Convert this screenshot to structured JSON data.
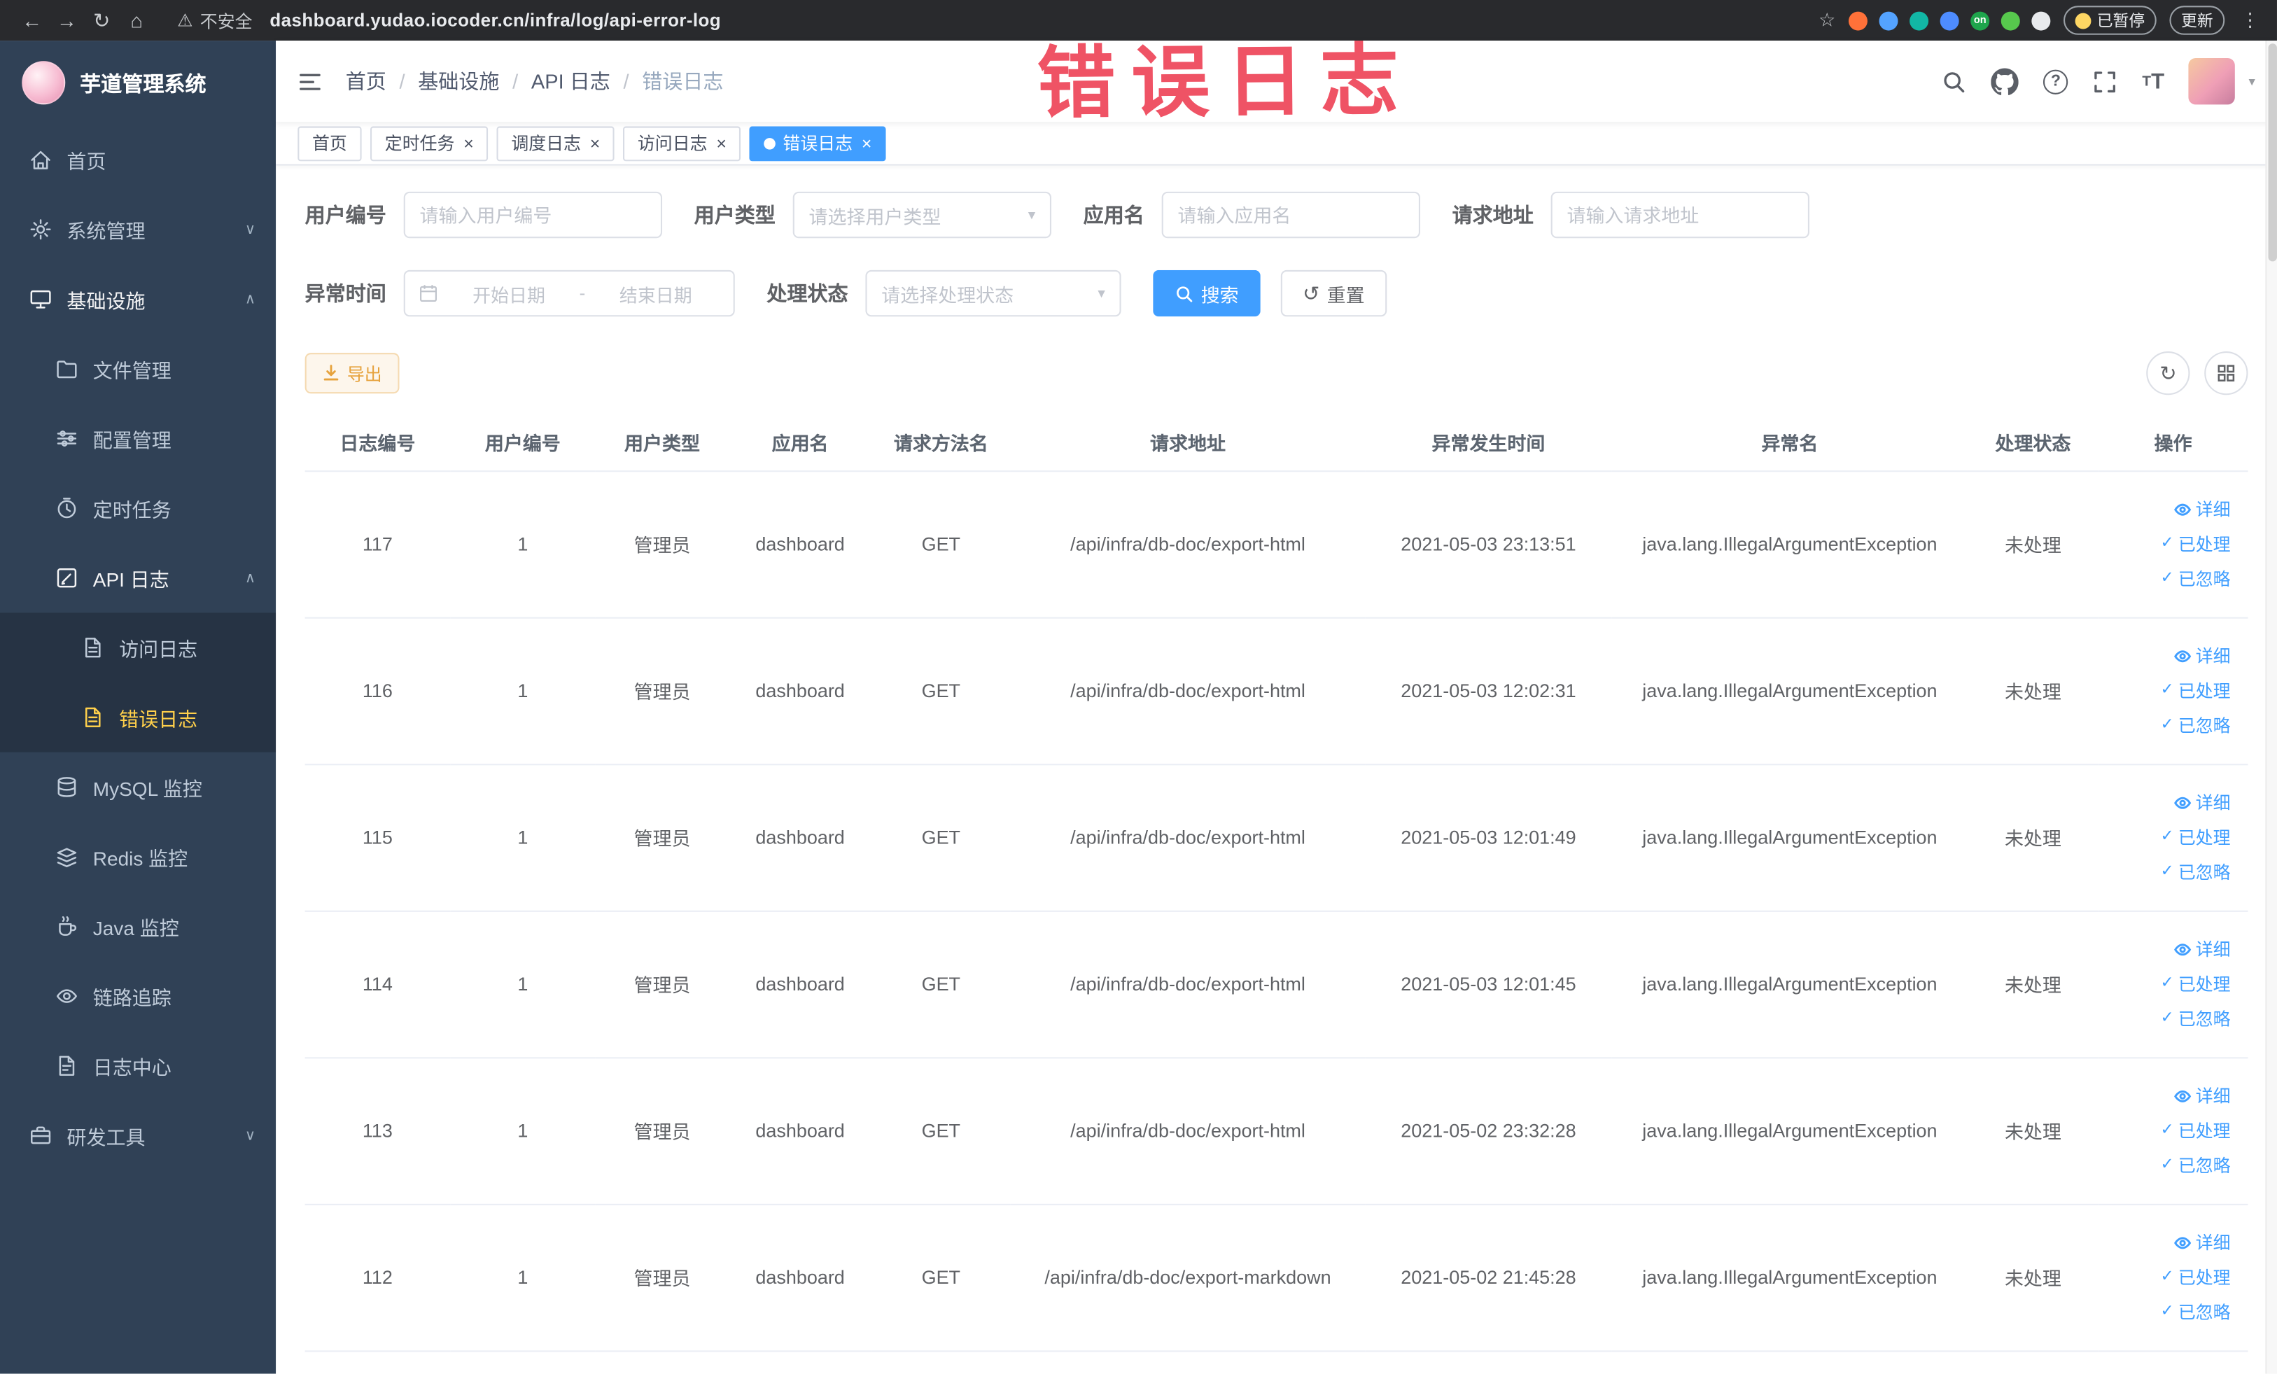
{
  "browser": {
    "security_label": "不安全",
    "url": "dashboard.yudao.iocoder.cn/infra/log/api-error-log",
    "extensions": [
      {
        "name": "ext-orange-icon",
        "color": "#ff7139"
      },
      {
        "name": "ext-blue-drop-icon",
        "color": "#54a3ff"
      },
      {
        "name": "ext-teal-icon",
        "color": "#12b7a5"
      },
      {
        "name": "ext-blue-grid-icon",
        "color": "#4e8cff"
      },
      {
        "name": "ext-on-badge-icon",
        "color": "#1ea54c",
        "label": "on"
      },
      {
        "name": "ext-leaf-icon",
        "color": "#57c84d"
      },
      {
        "name": "ext-paw-icon",
        "color": "#e8eaed"
      }
    ],
    "paused_label": "已暂停",
    "update_label": "更新"
  },
  "annotation": {
    "text": "错误日志"
  },
  "sidebar": {
    "title": "芋道管理系统",
    "items": [
      {
        "label": "首页",
        "icon": "home",
        "level": 1
      },
      {
        "label": "系统管理",
        "icon": "system",
        "level": 1,
        "chevron": "down"
      },
      {
        "label": "基础设施",
        "icon": "infra",
        "level": 1,
        "chevron": "up",
        "open": true
      },
      {
        "label": "文件管理",
        "icon": "file",
        "level": 2
      },
      {
        "label": "配置管理",
        "icon": "config",
        "level": 2
      },
      {
        "label": "定时任务",
        "icon": "timer",
        "level": 2
      },
      {
        "label": "API 日志",
        "icon": "api",
        "level": 2,
        "chevron": "up",
        "open": true
      },
      {
        "label": "访问日志",
        "icon": "doc",
        "level": 3
      },
      {
        "label": "错误日志",
        "icon": "doc",
        "level": 3,
        "active": true
      },
      {
        "label": "MySQL 监控",
        "icon": "mysql",
        "level": 2
      },
      {
        "label": "Redis 监控",
        "icon": "redis",
        "level": 2
      },
      {
        "label": "Java 监控",
        "icon": "java",
        "level": 2
      },
      {
        "label": "链路追踪",
        "icon": "trace",
        "level": 2
      },
      {
        "label": "日志中心",
        "icon": "logcenter",
        "level": 2
      },
      {
        "label": "研发工具",
        "icon": "tools",
        "level": 1,
        "chevron": "down"
      }
    ]
  },
  "header": {
    "separator": "/",
    "breadcrumb": [
      {
        "label": "首页"
      },
      {
        "label": "基础设施"
      },
      {
        "label": "API 日志"
      },
      {
        "label": "错误日志",
        "last": true
      }
    ]
  },
  "tags": [
    {
      "label": "首页"
    },
    {
      "label": "定时任务",
      "closable": true
    },
    {
      "label": "调度日志",
      "closable": true
    },
    {
      "label": "访问日志",
      "closable": true
    },
    {
      "label": "错误日志",
      "closable": true,
      "active": true
    }
  ],
  "filters": {
    "user_id": {
      "label": "用户编号",
      "placeholder": "请输入用户编号"
    },
    "user_type": {
      "label": "用户类型",
      "placeholder": "请选择用户类型"
    },
    "app_name": {
      "label": "应用名",
      "placeholder": "请输入应用名"
    },
    "request_url": {
      "label": "请求地址",
      "placeholder": "请输入请求地址"
    },
    "exception_time": {
      "label": "异常时间",
      "start_placeholder": "开始日期",
      "separator": "-",
      "end_placeholder": "结束日期"
    },
    "process_status": {
      "label": "处理状态",
      "placeholder": "请选择处理状态"
    },
    "search_label": "搜索",
    "reset_label": "重置"
  },
  "toolbar": {
    "export_label": "导出"
  },
  "table": {
    "columns": [
      "日志编号",
      "用户编号",
      "用户类型",
      "应用名",
      "请求方法名",
      "请求地址",
      "异常发生时间",
      "异常名",
      "处理状态",
      "操作"
    ],
    "actions": [
      "详细",
      "已处理",
      "已忽略"
    ],
    "rows": [
      {
        "id": "117",
        "user_id": "1",
        "user_type": "管理员",
        "app": "dashboard",
        "method": "GET",
        "url": "/api/infra/db-doc/export-html",
        "time": "2021-05-03 23:13:51",
        "exception": "java.lang.IllegalArgumentException",
        "status": "未处理"
      },
      {
        "id": "116",
        "user_id": "1",
        "user_type": "管理员",
        "app": "dashboard",
        "method": "GET",
        "url": "/api/infra/db-doc/export-html",
        "time": "2021-05-03 12:02:31",
        "exception": "java.lang.IllegalArgumentException",
        "status": "未处理"
      },
      {
        "id": "115",
        "user_id": "1",
        "user_type": "管理员",
        "app": "dashboard",
        "method": "GET",
        "url": "/api/infra/db-doc/export-html",
        "time": "2021-05-03 12:01:49",
        "exception": "java.lang.IllegalArgumentException",
        "status": "未处理"
      },
      {
        "id": "114",
        "user_id": "1",
        "user_type": "管理员",
        "app": "dashboard",
        "method": "GET",
        "url": "/api/infra/db-doc/export-html",
        "time": "2021-05-03 12:01:45",
        "exception": "java.lang.IllegalArgumentException",
        "status": "未处理"
      },
      {
        "id": "113",
        "user_id": "1",
        "user_type": "管理员",
        "app": "dashboard",
        "method": "GET",
        "url": "/api/infra/db-doc/export-html",
        "time": "2021-05-02 23:32:28",
        "exception": "java.lang.IllegalArgumentException",
        "status": "未处理"
      },
      {
        "id": "112",
        "user_id": "1",
        "user_type": "管理员",
        "app": "dashboard",
        "method": "GET",
        "url": "/api/infra/db-doc/export-markdown",
        "time": "2021-05-02 21:45:28",
        "exception": "java.lang.IllegalArgumentException",
        "status": "未处理"
      }
    ]
  },
  "colors": {
    "accent": "#409eff",
    "sidebar": "#304156",
    "active_menu": "#ffd04b",
    "warning": "#e6a23c",
    "annotation": "#ee4558"
  }
}
